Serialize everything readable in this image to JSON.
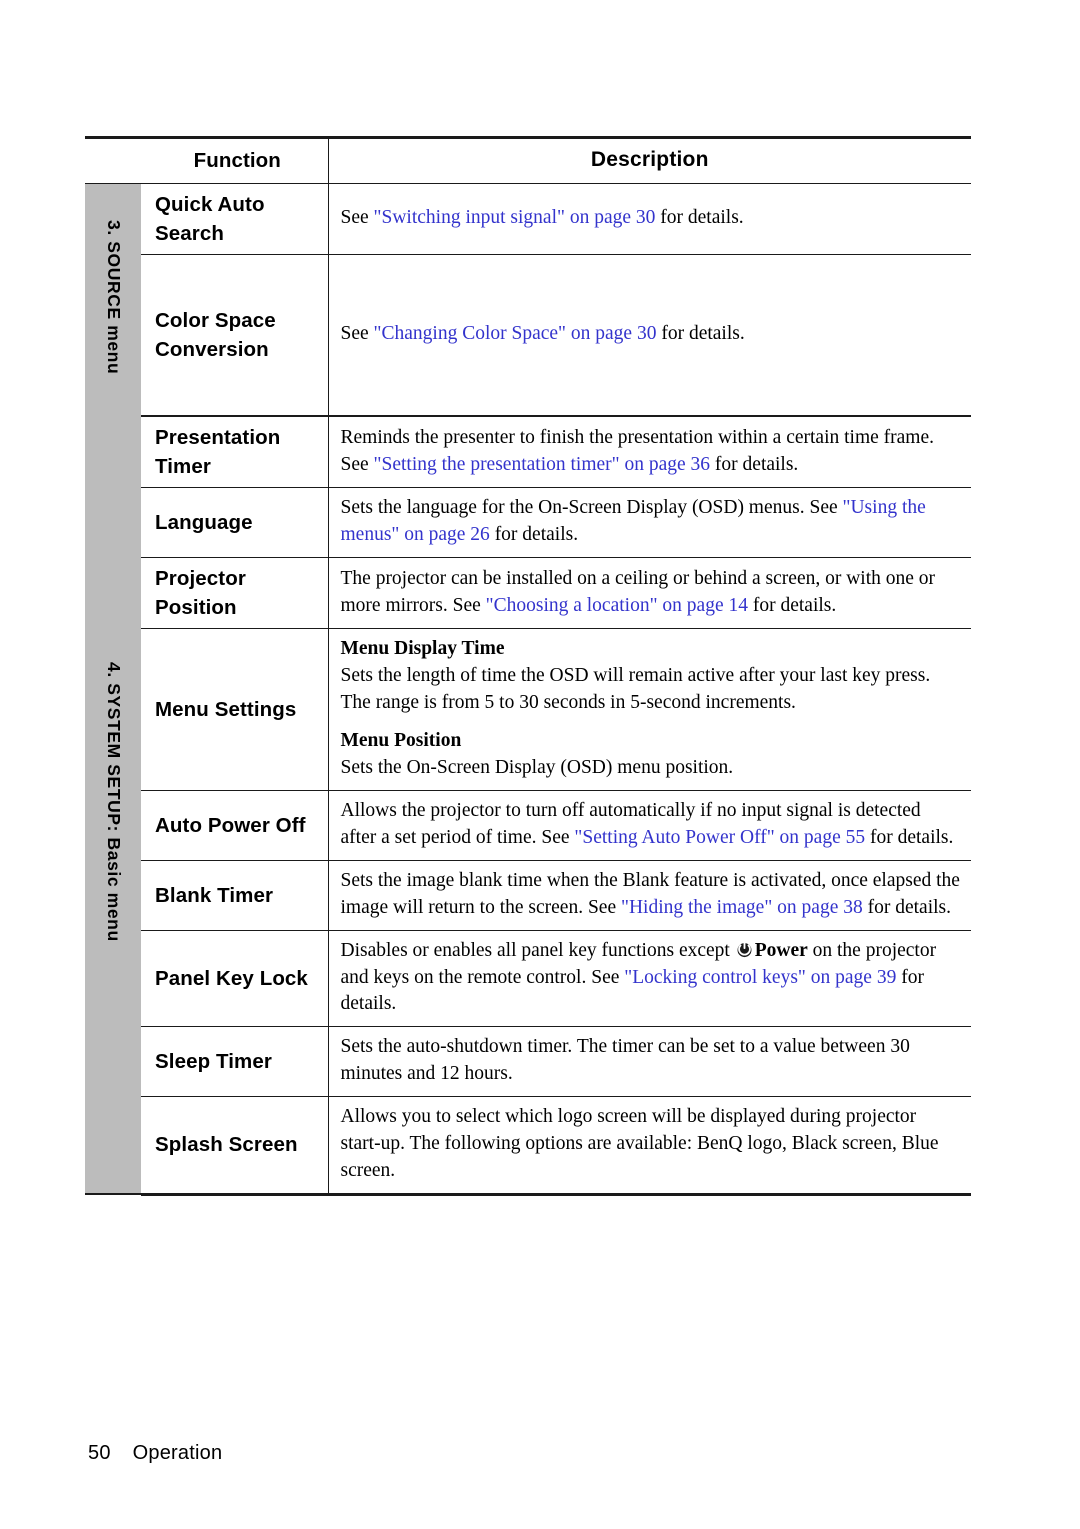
{
  "document": {
    "page_number": "50",
    "footer_section": "Operation"
  },
  "table": {
    "headers": {
      "function": "Function",
      "description": "Description"
    },
    "sections": [
      {
        "sidebar_label": "3. SOURCE menu",
        "rows": [
          {
            "function": "Quick Auto Search",
            "description_parts": [
              {
                "text": "See ",
                "link": false
              },
              {
                "text": "\"Switching input signal\" on page 30",
                "link": true
              },
              {
                "text": " for details.",
                "link": false
              }
            ]
          },
          {
            "function": "Color Space Conversion",
            "description_parts": [
              {
                "text": "See ",
                "link": false
              },
              {
                "text": "\"Changing Color Space\" on page 30",
                "link": true
              },
              {
                "text": " for details.",
                "link": false
              }
            ]
          }
        ]
      },
      {
        "sidebar_label": "4. SYSTEM SETUP: Basic menu",
        "rows": [
          {
            "function": "Presentation Timer",
            "description_parts": [
              {
                "text": "Reminds the presenter to finish the presentation within a certain time frame. See ",
                "link": false
              },
              {
                "text": "\"Setting the presentation timer\" on page 36",
                "link": true
              },
              {
                "text": " for details.",
                "link": false
              }
            ]
          },
          {
            "function": "Language",
            "description_parts": [
              {
                "text": "Sets the language for the On-Screen Display (OSD) menus. See ",
                "link": false
              },
              {
                "text": "\"Using the menus\" on page 26",
                "link": true
              },
              {
                "text": " for details.",
                "link": false
              }
            ]
          },
          {
            "function": "Projector Position",
            "description_parts": [
              {
                "text": "The projector can be installed on a ceiling or behind a screen, or with one or more mirrors. See ",
                "link": false
              },
              {
                "text": "\"Choosing a location\" on page 14",
                "link": true
              },
              {
                "text": " for details.",
                "link": false
              }
            ]
          },
          {
            "function": "Menu Settings",
            "subsections": [
              {
                "heading": "Menu Display Time",
                "body": "Sets the length of time the OSD will remain active after your last key press. The range is from 5 to 30 seconds in 5-second increments."
              },
              {
                "heading": "Menu Position",
                "body": "Sets the On-Screen Display (OSD) menu position."
              }
            ]
          },
          {
            "function": "Auto Power Off",
            "description_parts": [
              {
                "text": "Allows the projector to turn off automatically if no input signal is detected after a set period of time. See ",
                "link": false
              },
              {
                "text": "\"Setting Auto Power Off\" on page 55",
                "link": true
              },
              {
                "text": " for details.",
                "link": false
              }
            ]
          },
          {
            "function": "Blank Timer",
            "description_parts": [
              {
                "text": "Sets the image blank time when the Blank feature is activated, once elapsed the image will return to the screen. See ",
                "link": false
              },
              {
                "text": "\"Hiding the image\" on page 38",
                "link": true
              },
              {
                "text": " for details.",
                "link": false
              }
            ]
          },
          {
            "function": "Panel Key Lock",
            "description_parts": [
              {
                "text": "Disables or enables all panel key functions except ",
                "link": false
              },
              {
                "icon": "power-icon"
              },
              {
                "text": "Power",
                "bold": true
              },
              {
                "text": " on the projector and keys on the remote control. See ",
                "link": false
              },
              {
                "text": "\"Locking control keys\" on page 39",
                "link": true
              },
              {
                "text": " for details.",
                "link": false
              }
            ]
          },
          {
            "function": "Sleep Timer",
            "description_parts": [
              {
                "text": "Sets the auto-shutdown timer. The timer can be set to a value between 30 minutes and 12 hours.",
                "link": false
              }
            ]
          },
          {
            "function": "Splash Screen",
            "description_parts": [
              {
                "text": "Allows you to select which logo screen will be displayed during projector start-up. The following options are available: BenQ logo, Black screen, Blue screen.",
                "link": false
              }
            ]
          }
        ]
      }
    ]
  },
  "colors": {
    "link": "#3333cc",
    "sidebar_gray": "#bcbcbc",
    "rule": "#1a1a1a"
  }
}
